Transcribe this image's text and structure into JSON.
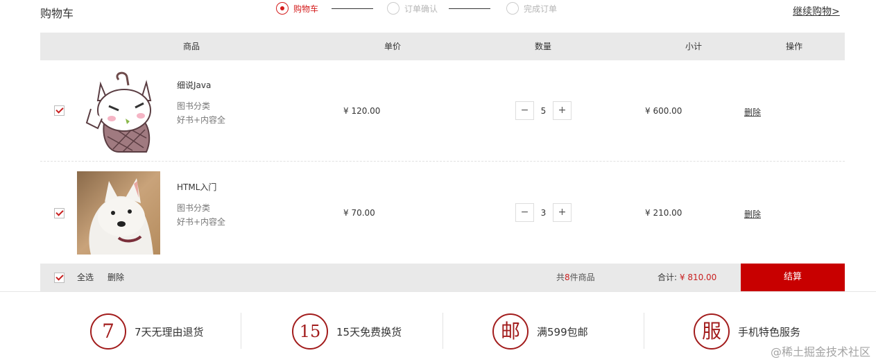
{
  "header": {
    "title": "购物车",
    "continue_shopping": "继续购物>",
    "steps": [
      {
        "label": "购物车",
        "active": true
      },
      {
        "label": "订单确认",
        "active": false
      },
      {
        "label": "完成订单",
        "active": false
      }
    ]
  },
  "table": {
    "columns": [
      "商品",
      "单价",
      "数量",
      "小计",
      "操作"
    ],
    "rows": [
      {
        "checked": true,
        "name": "细说Java",
        "category": "图书分类",
        "tag": "好书+内容全",
        "price": "¥ 120.00",
        "quantity": "5",
        "subtotal": "¥ 600.00",
        "action": "删除",
        "image_icon": "cartoon-cat-image"
      },
      {
        "checked": true,
        "name": "HTML入门",
        "category": "图书分类",
        "tag": "好书+内容全",
        "price": "¥ 70.00",
        "quantity": "3",
        "subtotal": "¥ 210.00",
        "action": "删除",
        "image_icon": "white-dog-photo"
      }
    ],
    "qty_minus": "−",
    "qty_plus": "+"
  },
  "summary": {
    "select_all": "全选",
    "delete": "删除",
    "count_prefix": "共",
    "count": "8",
    "count_suffix": "件商品",
    "total_label": "合计:",
    "total_value": "¥ 810.00",
    "checkout": "结算"
  },
  "services": [
    {
      "icon": "7",
      "text": "7天无理由退货"
    },
    {
      "icon": "15",
      "text": "15天免费换货"
    },
    {
      "icon": "邮",
      "text": "满599包邮"
    },
    {
      "icon": "服",
      "text": "手机特色服务"
    }
  ],
  "watermark": "@稀土掘金技术社区",
  "colors": {
    "accent": "#c80000",
    "step_active": "#d41c1c",
    "header_bg": "#e9e9e9",
    "service_ring": "#a21c1c"
  }
}
